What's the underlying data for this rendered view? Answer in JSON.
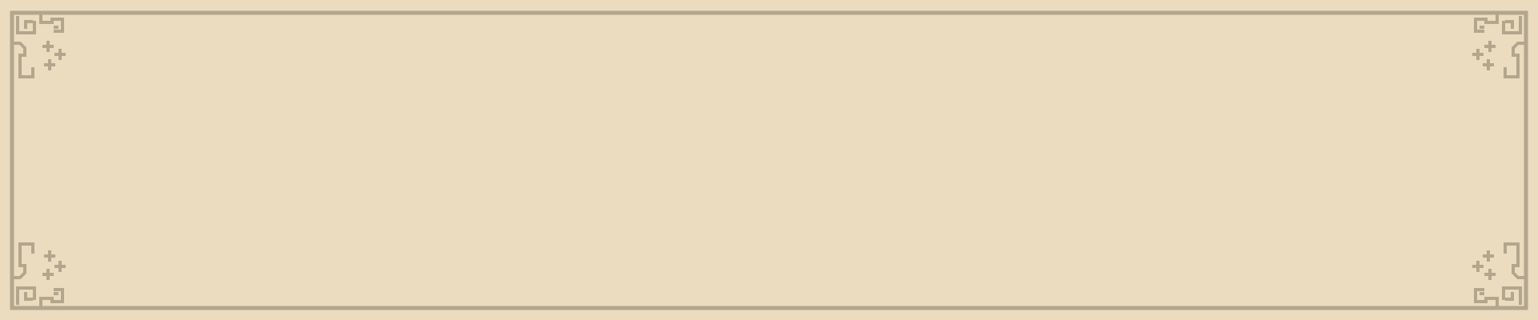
{
  "panel": {
    "style": "pixel-art parchment frame",
    "background_color": "#ebdcbf",
    "border_color": "#b2a68e",
    "content": ""
  },
  "corners": {
    "top_left": "swirl-ornament-icon",
    "top_right": "swirl-ornament-icon",
    "bottom_left": "swirl-ornament-icon",
    "bottom_right": "swirl-ornament-icon"
  }
}
